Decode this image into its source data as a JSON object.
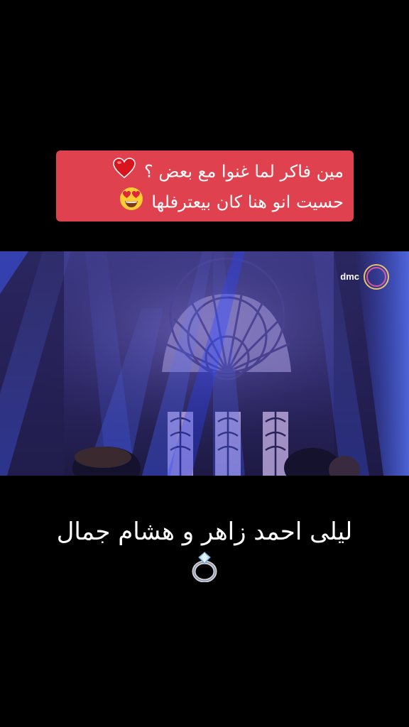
{
  "top_caption": {
    "line1": "مين فاكر لما غنوا مع بعض ؟",
    "line1_emoji": "red-heart",
    "line2": "حسيت انو هنا كان بيعترفلها",
    "line2_emoji": "heart-eyes-face",
    "background_color": "#e0414f"
  },
  "video": {
    "channel_logo_text": "dmc",
    "scene": "stage with purple and blue spotlights, arched ornate window backdrop"
  },
  "bottom_caption": {
    "line1": "ليلى احمد زاهر و هشام جمال",
    "emoji": "ring"
  }
}
